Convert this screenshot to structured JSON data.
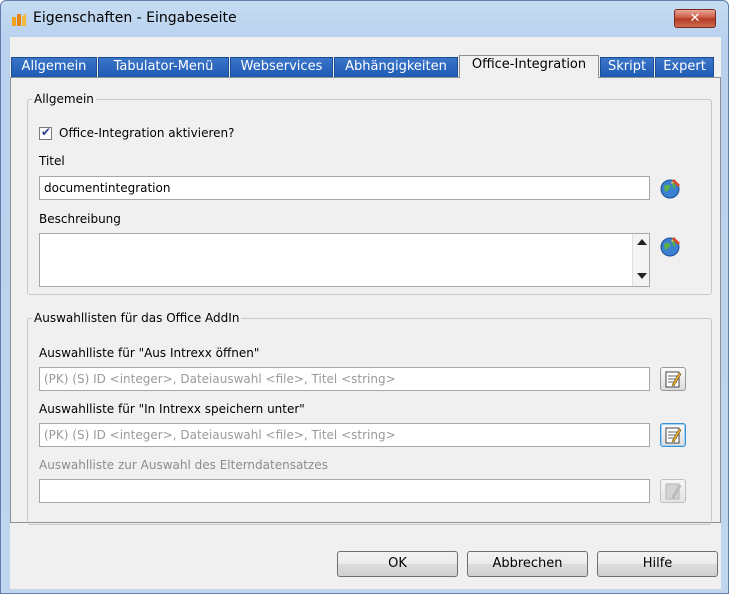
{
  "window": {
    "title": "Eigenschaften - Eingabeseite",
    "close_label": "✕"
  },
  "tabs": [
    {
      "label": "Allgemein",
      "active": false
    },
    {
      "label": "Tabulator-Menü",
      "active": false
    },
    {
      "label": "Webservices",
      "active": false
    },
    {
      "label": "Abhängigkeiten",
      "active": false
    },
    {
      "label": "Office-Integration",
      "active": true
    },
    {
      "label": "Skript",
      "active": false
    },
    {
      "label": "Expert",
      "active": false
    }
  ],
  "general_group": {
    "label": "Allgemein",
    "checkbox_label": "Office-Integration aktivieren?",
    "checkbox_checked": true,
    "title_label": "Titel",
    "title_value": "documentintegration",
    "description_label": "Beschreibung",
    "description_value": ""
  },
  "selection_group": {
    "label": "Auswahllisten für das Office AddIn",
    "open_label": "Auswahlliste für \"Aus Intrexx öffnen\"",
    "open_value": "(PK) (S) ID <integer>, Dateiauswahl <file>, Titel <string>",
    "save_label": "Auswahlliste für \"In Intrexx speichern unter\"",
    "save_value": "(PK) (S) ID <integer>, Dateiauswahl <file>, Titel <string>",
    "parent_label": "Auswahlliste zur Auswahl des Elterndatensatzes",
    "parent_value": ""
  },
  "buttons": {
    "ok": "OK",
    "cancel": "Abbrechen",
    "help": "Hilfe"
  },
  "colors": {
    "tab_inactive": "#2a66bd",
    "title_bar": "#c6dcf3"
  }
}
